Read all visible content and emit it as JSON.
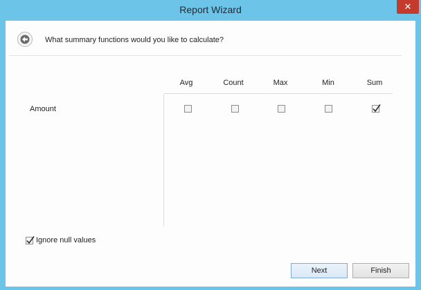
{
  "window": {
    "title": "Report Wizard",
    "close_glyph": "✕"
  },
  "wizard": {
    "back_icon": "back-arrow-icon",
    "question": "What summary functions would you like to calculate?"
  },
  "grid": {
    "columns": [
      "Avg",
      "Count",
      "Max",
      "Min",
      "Sum"
    ],
    "rows": [
      {
        "label": "Amount",
        "checked": [
          false,
          false,
          false,
          false,
          true
        ]
      }
    ]
  },
  "options": {
    "ignore_null_label": "Ignore null values",
    "ignore_null_checked": true
  },
  "buttons": {
    "next": "Next",
    "finish": "Finish"
  },
  "colors": {
    "frame": "#6cc5e9",
    "close": "#c43b2e",
    "client": "#fdfdfd"
  }
}
